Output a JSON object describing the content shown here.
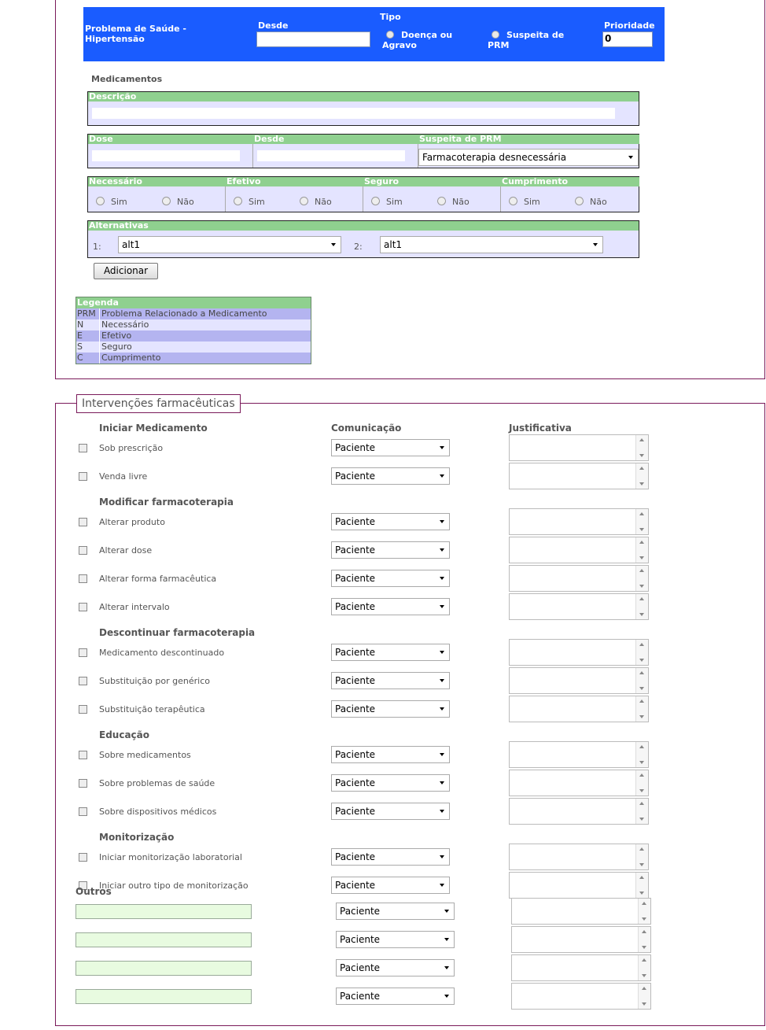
{
  "problem": {
    "title": "Problema de Saúde - Hipertensão",
    "desde_label": "Desde",
    "desde_value": "",
    "tipo_label": "Tipo",
    "tipo_opt1": "Doença ou Agravo",
    "tipo_opt2": "Suspeita de PRM",
    "prioridade_label": "Prioridade",
    "prioridade_value": "0"
  },
  "medicamentos": {
    "label": "Medicamentos",
    "descricao_label": "Descrição",
    "dose_label": "Dose",
    "desde_label": "Desde",
    "suspeita_label": "Suspeita de PRM",
    "suspeita_value": "Farmacoterapia desnecessária",
    "criteria": [
      {
        "label": "Necessário",
        "sim": "Sim",
        "nao": "Não"
      },
      {
        "label": "Efetivo",
        "sim": "Sim",
        "nao": "Não"
      },
      {
        "label": "Seguro",
        "sim": "Sim",
        "nao": "Não"
      },
      {
        "label": "Cumprimento",
        "sim": "Sim",
        "nao": "Não"
      }
    ],
    "alternativas_label": "Alternativas",
    "alt1_num": "1:",
    "alt1_value": "alt1",
    "alt2_num": "2:",
    "alt2_value": "alt1",
    "add_button": "Adicionar"
  },
  "legenda": {
    "title": "Legenda",
    "rows": [
      {
        "k": "PRM",
        "v": "Problema Relacionado a Medicamento"
      },
      {
        "k": "N",
        "v": "Necessário"
      },
      {
        "k": "E",
        "v": "Efetivo"
      },
      {
        "k": "S",
        "v": "Seguro"
      },
      {
        "k": "C",
        "v": "Cumprimento"
      }
    ]
  },
  "interventions": {
    "title": "Intervenções farmacêuticas",
    "col_comunicacao": "Comunicação",
    "col_justificativa": "Justificativa",
    "categories": [
      {
        "name": "Iniciar Medicamento",
        "items": [
          "Sob prescrição",
          "Venda livre"
        ]
      },
      {
        "name": "Modificar farmacoterapia",
        "items": [
          "Alterar produto",
          "Alterar dose",
          "Alterar forma farmacêutica",
          "Alterar intervalo"
        ]
      },
      {
        "name": "Descontinuar farmacoterapia",
        "items": [
          "Medicamento descontinuado",
          "Substituição por genérico",
          "Substituição terapêutica"
        ]
      },
      {
        "name": "Educação",
        "items": [
          "Sobre medicamentos",
          "Sobre problemas de saúde",
          "Sobre dispositivos médicos"
        ]
      },
      {
        "name": "Monitorização",
        "items": [
          "Iniciar monitorização laboratorial",
          "Iniciar outro tipo de monitorização"
        ]
      }
    ],
    "comm_default": "Paciente",
    "outros_label": "Outros",
    "outros_rows": 4
  }
}
